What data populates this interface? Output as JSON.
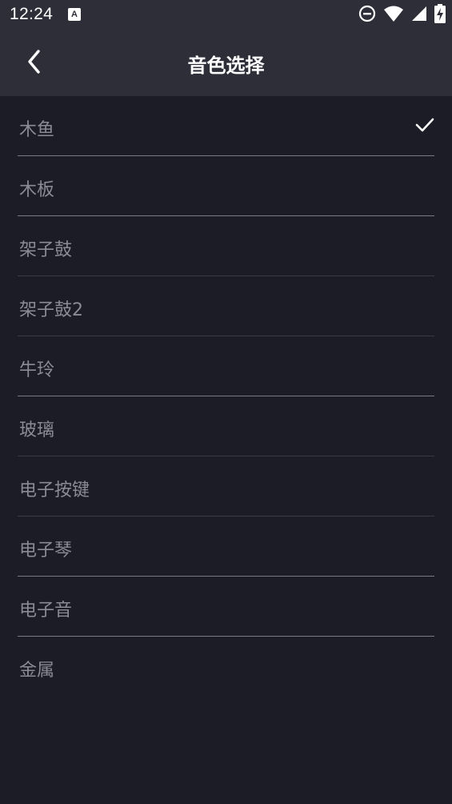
{
  "status_bar": {
    "time": "12:24",
    "notification_icon_letter": "A",
    "icons": [
      "a-notification-icon",
      "do-not-disturb-icon",
      "wifi-icon",
      "cell-signal-icon",
      "battery-charging-icon"
    ]
  },
  "header": {
    "title": "音色选择",
    "back_icon": "chevron-left-icon"
  },
  "colors": {
    "background": "#1c1c26",
    "header_background": "#2e2e39",
    "text_primary": "#ffffff",
    "text_item": "#8b8b97",
    "divider_bright": "#7a7a86",
    "divider_dim": "#3a3a46"
  },
  "sound_list": {
    "selected_index": 0,
    "items": [
      {
        "label": "木鱼",
        "selected": true
      },
      {
        "label": "木板",
        "selected": false
      },
      {
        "label": "架子鼓",
        "selected": false
      },
      {
        "label": "架子鼓2",
        "selected": false
      },
      {
        "label": "牛玲",
        "selected": false
      },
      {
        "label": "玻璃",
        "selected": false
      },
      {
        "label": "电子按键",
        "selected": false
      },
      {
        "label": "电子琴",
        "selected": false
      },
      {
        "label": "电子音",
        "selected": false
      },
      {
        "label": "金属",
        "selected": false
      }
    ]
  }
}
